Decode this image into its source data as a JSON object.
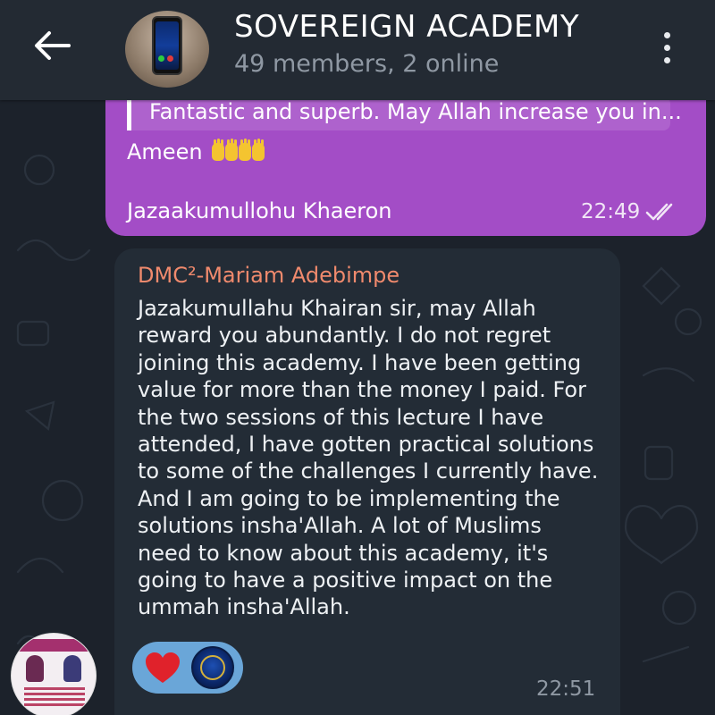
{
  "header": {
    "title": "SOVEREIGN ACADEMY",
    "subtitle": "49 members, 2 online"
  },
  "messages": [
    {
      "direction": "outgoing",
      "reply_quote": "Fantastic and superb. May Allah increase you in...",
      "line1": "Ameen",
      "line2": "Jazaakumullohu Khaeron",
      "time": "22:49",
      "status": "read"
    },
    {
      "direction": "incoming",
      "sender": "DMC²-Mariam Adebimpe",
      "lines": [
        "Jazakumullahu Khairan sir, may Allah",
        "reward you abundantly. I do not regret",
        "joining this academy. I have been getting",
        "value for more than the money I paid. For",
        "the two sessions of this lecture I have",
        "attended, I have gotten practical solutions",
        "to some of the challenges I currently have.",
        "And I am going to be implementing the",
        "solutions insha'Allah. A lot of Muslims",
        "need to know about this academy, it's",
        "going to have a positive impact on the",
        "ummah insha'Allah."
      ],
      "reaction": "heart",
      "time": "22:51"
    }
  ],
  "colors": {
    "header_bg": "#232a33",
    "outgoing_bubble": "#a34dc6",
    "incoming_bubble": "#232c36",
    "sender_name": "#f08a6d",
    "reaction_pill": "#6aa6d8"
  },
  "icons": {
    "back": "back-arrow-icon",
    "menu": "more-vertical-icon",
    "read_status": "double-check-icon",
    "reaction": "heart-icon",
    "emoji": "raised-hands-emoji"
  }
}
